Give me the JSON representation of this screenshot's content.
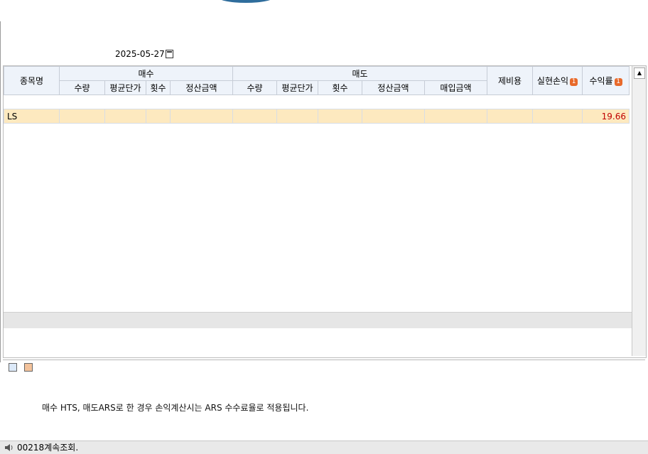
{
  "query": {
    "date": "2025-05-27",
    "calendar_icon": "calendar-icon"
  },
  "grid": {
    "header": {
      "name": "종목명",
      "buy_group": "매수",
      "sell_group": "매도",
      "fee": "제비용",
      "realized_pl": "실현손익",
      "return_rate": "수익률",
      "buy_cols": [
        "수량",
        "평균단가",
        "횟수",
        "정산금액"
      ],
      "sell_cols": [
        "수량",
        "평균단가",
        "횟수",
        "정산금액",
        "매입금액"
      ],
      "badge": "1"
    },
    "rows": [
      {
        "name": "LS",
        "return_rate": "19.66"
      }
    ]
  },
  "notice": {
    "text": "매수 HTS, 매도ARS로 한 경우 손익계산시는 ARS 수수료율로 적용됩니다."
  },
  "status": {
    "message": "00218계속조회.",
    "icon": "speaker-icon"
  },
  "colors": {
    "highlight_row": "#fde9bf",
    "header_bg": "#eef3fa",
    "value_red": "#c00000",
    "badge_orange": "#e8692a"
  }
}
